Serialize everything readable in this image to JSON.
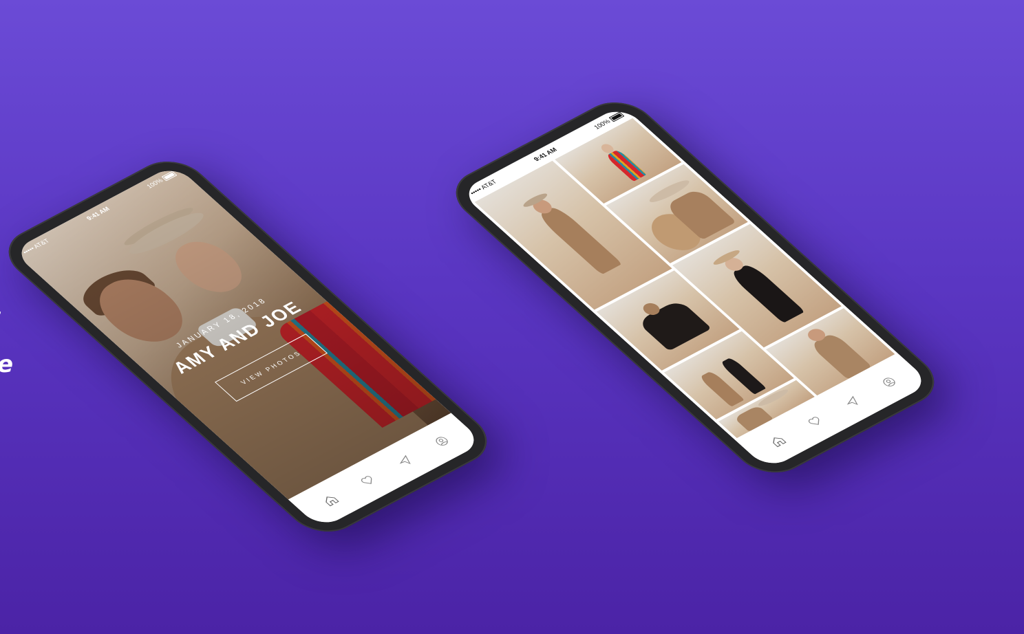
{
  "background": {
    "gradient_top": "#6b4bd6",
    "gradient_bottom": "#4b23a6"
  },
  "edge_text": {
    "dot": ",",
    "partial": "e"
  },
  "phone_left": {
    "status": {
      "carrier": "••••• AT&T",
      "time": "9:41 AM",
      "battery": "100%"
    },
    "hero": {
      "date": "JANUARY 18, 2018",
      "title": "AMY AND JOE",
      "button": "VIEW PHOTOS"
    },
    "tabs": [
      "home-icon",
      "heart-icon",
      "send-icon",
      "profile-icon"
    ]
  },
  "phone_right": {
    "status": {
      "carrier": "••••• AT&T",
      "time": "9:41 AM",
      "battery": "100%"
    },
    "photos": [
      {
        "name": "photo-man-standing"
      },
      {
        "name": "photo-woman-serape"
      },
      {
        "name": "photo-couple-kiss"
      },
      {
        "name": "photo-couple-sitting"
      },
      {
        "name": "photo-woman-dress"
      },
      {
        "name": "photo-couple-walking"
      },
      {
        "name": "photo-man-jacket"
      },
      {
        "name": "photo-couple-hat"
      }
    ],
    "tabs": [
      "home-icon",
      "heart-icon",
      "send-icon",
      "profile-icon"
    ]
  },
  "colors": {
    "phone_body": "#262628",
    "serape_red": "#d5262c",
    "accent_teal": "#2a8aa0"
  }
}
